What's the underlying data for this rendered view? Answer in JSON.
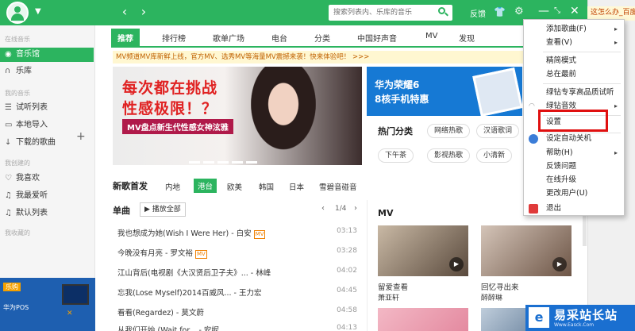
{
  "topbar": {
    "back": "‹",
    "forward": "›",
    "search_placeholder": "搜索列表内、乐库的音乐",
    "feedback": "反馈",
    "minimize": "—",
    "restore": "⤡",
    "close": "✕"
  },
  "browser_tab": "这怎么办_百度",
  "sidebar": {
    "head_online": "在线音乐",
    "head_mine": "我的音乐",
    "head_created": "我创建的",
    "head_fav": "我收藏的",
    "items": [
      {
        "label": "音乐馆",
        "icon": "◉"
      },
      {
        "label": "乐库",
        "icon": "∩"
      },
      {
        "label": "试听列表",
        "icon": "☰"
      },
      {
        "label": "本地导入",
        "icon": "▭"
      },
      {
        "label": "下载的歌曲",
        "icon": "↓"
      },
      {
        "label": "我喜欢",
        "icon": "♡"
      },
      {
        "label": "我最爱听",
        "icon": "♫"
      },
      {
        "label": "默认列表",
        "icon": "♫"
      }
    ],
    "ad_badge": "乐购",
    "ad_text": "华为POS"
  },
  "tabs": [
    "推荐",
    "排行榜",
    "歌单广场",
    "电台",
    "分类",
    "中国好声音",
    "MV",
    "发现"
  ],
  "notice": "MV频道MV库新鲜上线，官方MV、选秀MV等海量MV震撼来袭！快来体验吧！ >>>",
  "banner": {
    "line1": "每次都在挑战",
    "line2": "性感极限！？",
    "line3": "MV盘点新生代性感女神泫雅"
  },
  "promo": {
    "line1": "华为荣耀6",
    "line2": "8核手机特惠"
  },
  "hot": {
    "title": "热门分类",
    "tags": [
      "网络热歌",
      "汉语歌词",
      "下午茶",
      "影视热歌",
      "小清新"
    ]
  },
  "new_songs": {
    "title": "新歌首发",
    "regions": [
      "内地",
      "港台",
      "欧美",
      "韩国",
      "日本",
      "雪碧音碰音"
    ]
  },
  "singles": {
    "title": "单曲",
    "play_all": "▶ 播放全部",
    "page": "1/4",
    "prev": "‹",
    "next": "›",
    "mv_badge": "MV",
    "songs": [
      {
        "name": "我也想成为她(Wish I Were Her) - 白安",
        "mv": true,
        "duration": "03:13"
      },
      {
        "name": "今晚没有月亮 - 罗文裕",
        "mv": true,
        "duration": "03:28"
      },
      {
        "name": "江山背后(电视剧《大汉贤后卫子夫》... - 林峰",
        "mv": false,
        "duration": "04:02"
      },
      {
        "name": "忘我(Lose Myself)2014百威风... - 王力宏",
        "mv": false,
        "duration": "04:45"
      },
      {
        "name": "看看(Regardez) - 莫文蔚",
        "mv": false,
        "duration": "04:58"
      },
      {
        "name": "从我们开始 (Wait for... - 安妮",
        "mv": false,
        "duration": "04:13"
      }
    ]
  },
  "mv": {
    "title": "MV",
    "items": [
      {
        "name": "留爱查看",
        "artist": "萧亚轩"
      },
      {
        "name": "回忆寻出来",
        "artist": "醉醉琳"
      }
    ]
  },
  "menu": {
    "items": [
      {
        "label": "添加歌曲(F)",
        "arrow": "▸"
      },
      {
        "label": "查看(V)",
        "arrow": "▸"
      },
      {
        "label": "精简模式",
        "arrow": ""
      },
      {
        "label": "总在最前",
        "arrow": ""
      },
      {
        "label": "绿钻专享高品质试听",
        "arrow": ""
      },
      {
        "label": "绿钻音效",
        "arrow": "▸"
      },
      {
        "label": "设置",
        "arrow": ""
      },
      {
        "label": "设定自动关机",
        "arrow": ""
      },
      {
        "label": "帮助(H)",
        "arrow": "▸"
      },
      {
        "label": "反馈问题",
        "arrow": ""
      },
      {
        "label": "在线升级",
        "arrow": ""
      },
      {
        "label": "更改用户(U)",
        "arrow": ""
      },
      {
        "label": "退出",
        "arrow": ""
      }
    ]
  },
  "watermark": {
    "logo": "e",
    "title": "易采站长站",
    "url": "Www.Easck.Com"
  },
  "colors": {
    "brand": "#2cb45f",
    "highlight": "#e01010",
    "notice_text": "#c06000"
  }
}
